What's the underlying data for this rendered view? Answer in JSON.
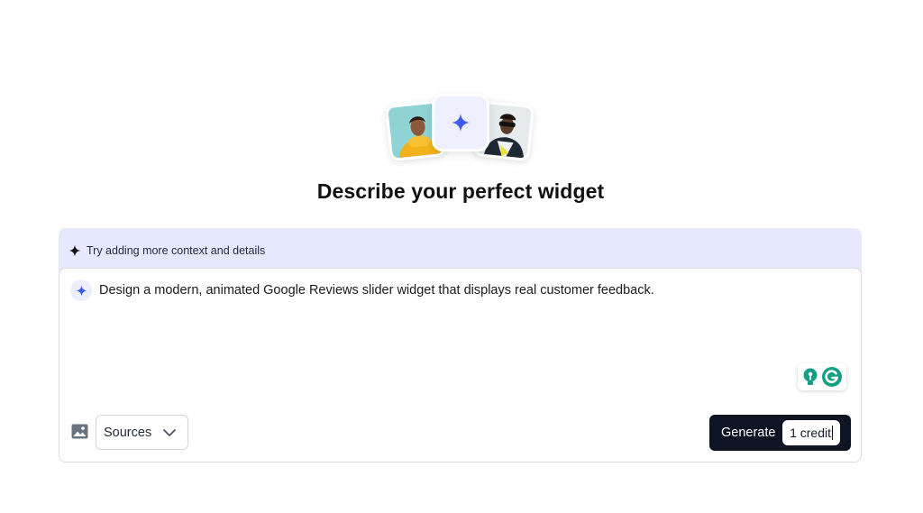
{
  "page": {
    "title": "Describe your perfect widget"
  },
  "hint": {
    "text": "Try adding more context and details"
  },
  "prompt": {
    "value": "Design a modern, animated Google Reviews slider widget that displays real customer feedback."
  },
  "toolbar": {
    "sources_label": "Sources",
    "generate_label": "Generate",
    "credit_label": "1 credit"
  },
  "icons": {
    "hint": "sparkle-icon",
    "prompt": "sparkle-icon",
    "image": "image-icon",
    "sources": "chevron-down-icon",
    "extensions": [
      "lightbulb-icon",
      "grammarly-icon"
    ]
  },
  "colors": {
    "accent": "#3b5bf5",
    "hint_bg": "#e6e9fd",
    "generate_bg": "#0e1424",
    "grammarly": "#15a085"
  }
}
